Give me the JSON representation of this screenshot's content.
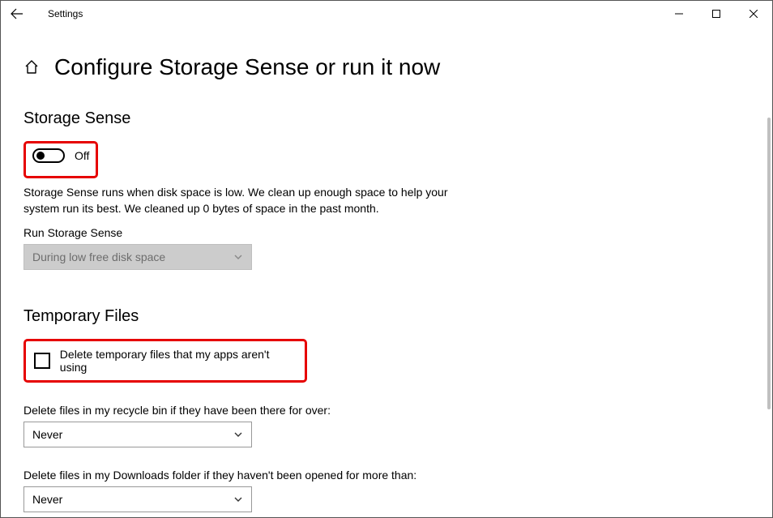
{
  "window": {
    "title": "Settings"
  },
  "page": {
    "title": "Configure Storage Sense or run it now"
  },
  "storage_sense": {
    "heading": "Storage Sense",
    "toggle_state": "Off",
    "description": "Storage Sense runs when disk space is low. We clean up enough space to help your system run its best. We cleaned up 0 bytes of space in the past month.",
    "run_label": "Run Storage Sense",
    "run_value": "During low free disk space"
  },
  "temp_files": {
    "heading": "Temporary Files",
    "delete_temp_label": "Delete temporary files that my apps aren't using",
    "recycle_label": "Delete files in my recycle bin if they have been there for over:",
    "recycle_value": "Never",
    "downloads_label": "Delete files in my Downloads folder if they haven't been opened for more than:",
    "downloads_value": "Never"
  }
}
